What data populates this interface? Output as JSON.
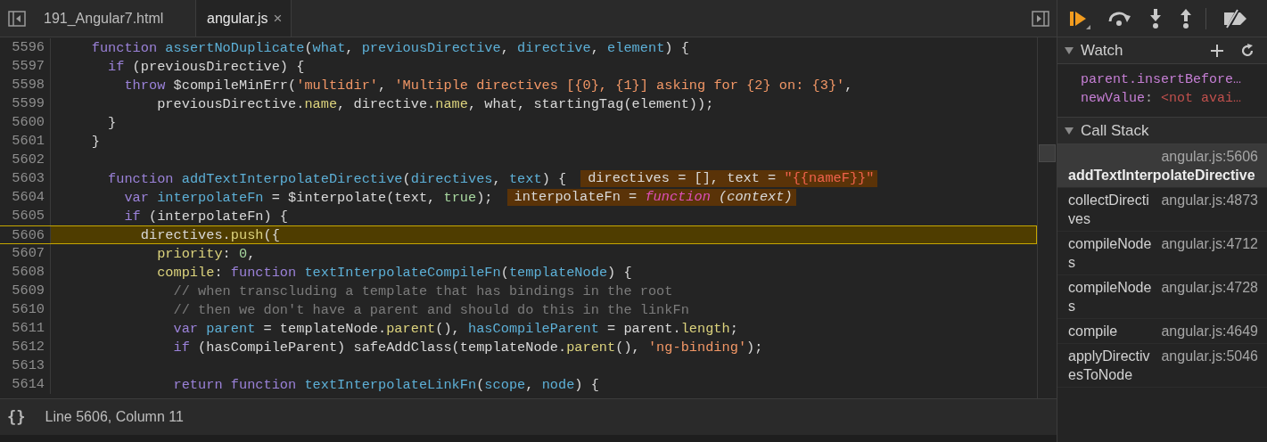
{
  "tabs": [
    {
      "label": "191_Angular7.html",
      "selected": false
    },
    {
      "label": "angular.js",
      "selected": true,
      "close": "×"
    }
  ],
  "code": {
    "lines": [
      {
        "number": "5596",
        "current": false,
        "tokens": [
          {
            "kind": "kw",
            "text": "    function "
          },
          {
            "kind": "def",
            "text": "assertNoDuplicate"
          },
          {
            "kind": "txt",
            "text": "("
          },
          {
            "kind": "def",
            "text": "what"
          },
          {
            "kind": "txt",
            "text": ", "
          },
          {
            "kind": "def",
            "text": "previousDirective"
          },
          {
            "kind": "txt",
            "text": ", "
          },
          {
            "kind": "def",
            "text": "directive"
          },
          {
            "kind": "txt",
            "text": ", "
          },
          {
            "kind": "def",
            "text": "element"
          },
          {
            "kind": "txt",
            "text": ") {"
          }
        ]
      },
      {
        "number": "5597",
        "current": false,
        "tokens": [
          {
            "kind": "kw",
            "text": "      if"
          },
          {
            "kind": "txt",
            "text": " (previousDirective) {"
          }
        ]
      },
      {
        "number": "5598",
        "current": false,
        "tokens": [
          {
            "kind": "kw",
            "text": "        throw"
          },
          {
            "kind": "txt",
            "text": " $compileMinErr("
          },
          {
            "kind": "str",
            "text": "'multidir'"
          },
          {
            "kind": "txt",
            "text": ", "
          },
          {
            "kind": "str",
            "text": "'Multiple directives [{0}, {1}] asking for {2} on: {3}'"
          },
          {
            "kind": "txt",
            "text": ","
          }
        ]
      },
      {
        "number": "5599",
        "current": false,
        "tokens": [
          {
            "kind": "txt",
            "text": "            previousDirective."
          },
          {
            "kind": "prop",
            "text": "name"
          },
          {
            "kind": "txt",
            "text": ", directive."
          },
          {
            "kind": "prop",
            "text": "name"
          },
          {
            "kind": "txt",
            "text": ", what, startingTag(element));"
          }
        ]
      },
      {
        "number": "5600",
        "current": false,
        "tokens": [
          {
            "kind": "txt",
            "text": "      }"
          }
        ]
      },
      {
        "number": "5601",
        "current": false,
        "tokens": [
          {
            "kind": "txt",
            "text": "    }"
          }
        ]
      },
      {
        "number": "5602",
        "current": false
      },
      {
        "number": "5603",
        "current": false,
        "tokens": [
          {
            "kind": "kw",
            "text": "      function "
          },
          {
            "kind": "def",
            "text": "addTextInterpolateDirective"
          },
          {
            "kind": "txt",
            "text": "("
          },
          {
            "kind": "def",
            "text": "directives"
          },
          {
            "kind": "txt",
            "text": ", "
          },
          {
            "kind": "def",
            "text": "text"
          },
          {
            "kind": "txt",
            "text": ") {"
          }
        ],
        "inline_value": [
          {
            "kind": "txt",
            "text": "directives = [], text = "
          },
          {
            "kind": "str",
            "text": "\"{{nameF}}\""
          }
        ]
      },
      {
        "number": "5604",
        "current": false,
        "tokens": [
          {
            "kind": "kw",
            "text": "        var "
          },
          {
            "kind": "def",
            "text": "interpolateFn"
          },
          {
            "kind": "txt",
            "text": " = $interpolate(text, "
          },
          {
            "kind": "num",
            "text": "true"
          },
          {
            "kind": "txt",
            "text": ");"
          }
        ],
        "inline_value": [
          {
            "kind": "txt",
            "text": "interpolateFn = "
          },
          {
            "kind": "fnval",
            "text": "function"
          },
          {
            "kind": "ital",
            "text": " (context)"
          }
        ]
      },
      {
        "number": "5605",
        "current": false,
        "tokens": [
          {
            "kind": "kw",
            "text": "        if"
          },
          {
            "kind": "txt",
            "text": " (interpolateFn) {"
          }
        ]
      },
      {
        "number": "5606",
        "current": true,
        "tokens": [
          {
            "kind": "txt",
            "text": "          directives."
          },
          {
            "kind": "prop",
            "text": "push"
          },
          {
            "kind": "txt",
            "text": "({"
          }
        ]
      },
      {
        "number": "5607",
        "current": false,
        "tokens": [
          {
            "kind": "prop",
            "text": "            priority"
          },
          {
            "kind": "txt",
            "text": ": "
          },
          {
            "kind": "num",
            "text": "0"
          },
          {
            "kind": "txt",
            "text": ","
          }
        ]
      },
      {
        "number": "5608",
        "current": false,
        "tokens": [
          {
            "kind": "prop",
            "text": "            compile"
          },
          {
            "kind": "txt",
            "text": ": "
          },
          {
            "kind": "kw",
            "text": "function "
          },
          {
            "kind": "def",
            "text": "textInterpolateCompileFn"
          },
          {
            "kind": "txt",
            "text": "("
          },
          {
            "kind": "def",
            "text": "templateNode"
          },
          {
            "kind": "txt",
            "text": ") {"
          }
        ]
      },
      {
        "number": "5609",
        "current": false,
        "tokens": [
          {
            "kind": "com",
            "text": "              // when transcluding a template that has bindings in the root"
          }
        ]
      },
      {
        "number": "5610",
        "current": false,
        "tokens": [
          {
            "kind": "com",
            "text": "              // then we don't have a parent and should do this in the linkFn"
          }
        ]
      },
      {
        "number": "5611",
        "current": false,
        "tokens": [
          {
            "kind": "kw",
            "text": "              var "
          },
          {
            "kind": "def",
            "text": "parent"
          },
          {
            "kind": "txt",
            "text": " = templateNode."
          },
          {
            "kind": "prop",
            "text": "parent"
          },
          {
            "kind": "txt",
            "text": "(), "
          },
          {
            "kind": "def",
            "text": "hasCompileParent"
          },
          {
            "kind": "txt",
            "text": " = parent."
          },
          {
            "kind": "prop",
            "text": "length"
          },
          {
            "kind": "txt",
            "text": ";"
          }
        ]
      },
      {
        "number": "5612",
        "current": false,
        "tokens": [
          {
            "kind": "kw",
            "text": "              if"
          },
          {
            "kind": "txt",
            "text": " (hasCompileParent) safeAddClass(templateNode."
          },
          {
            "kind": "prop",
            "text": "parent"
          },
          {
            "kind": "txt",
            "text": "(), "
          },
          {
            "kind": "str",
            "text": "'ng-binding'"
          },
          {
            "kind": "txt",
            "text": ");"
          }
        ]
      },
      {
        "number": "5613",
        "current": false
      },
      {
        "number": "5614",
        "current": false,
        "tokens": [
          {
            "kind": "kw",
            "text": "              return function "
          },
          {
            "kind": "def",
            "text": "textInterpolateLinkFn"
          },
          {
            "kind": "txt",
            "text": "("
          },
          {
            "kind": "def",
            "text": "scope"
          },
          {
            "kind": "txt",
            "text": ", "
          },
          {
            "kind": "def",
            "text": "node"
          },
          {
            "kind": "txt",
            "text": ") {"
          }
        ]
      }
    ]
  },
  "status_bar": {
    "pretty_print": "{}",
    "position": "Line 5606, Column 11"
  },
  "watch": {
    "title": "Watch",
    "expanded": true,
    "items": [
      {
        "expression": "parent.insertBefore…"
      },
      {
        "expression": "newValue",
        "separator": ":",
        "value": "<not avai…"
      }
    ]
  },
  "call_stack": {
    "title": "Call Stack",
    "expanded": true,
    "frames": [
      {
        "name": "addTextInterpolateDirective",
        "location": "angular.js:5606",
        "selected": true
      },
      {
        "name": "collectDirectives",
        "location": "angular.js:4873",
        "selected": false
      },
      {
        "name": "compileNodes",
        "location": "angular.js:4712",
        "selected": false
      },
      {
        "name": "compileNodes",
        "location": "angular.js:4728",
        "selected": false
      },
      {
        "name": "compile",
        "location": "angular.js:4649",
        "selected": false
      },
      {
        "name": "applyDirectivesToNode",
        "location": "angular.js:5046",
        "selected": false
      }
    ]
  }
}
